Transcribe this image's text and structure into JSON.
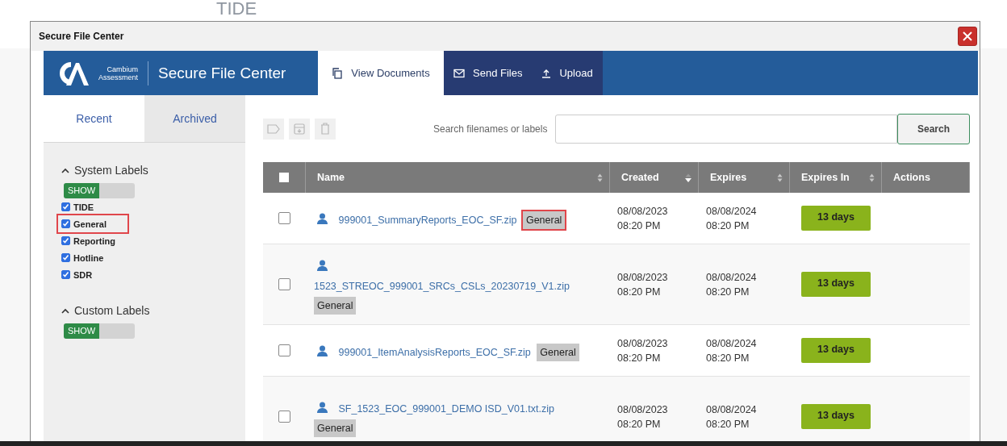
{
  "background": {
    "app_title": "TIDE"
  },
  "dialog": {
    "title": "Secure File Center"
  },
  "header": {
    "brand_line_1": "Cambium",
    "brand_line_2": "Assessment",
    "title": "Secure File Center",
    "nav": [
      {
        "label": "View Documents",
        "kind": "copy",
        "selected": true
      },
      {
        "label": "Send Files",
        "kind": "mail",
        "selected": false
      },
      {
        "label": "Upload",
        "kind": "upload",
        "selected": false
      }
    ]
  },
  "sidebar": {
    "tabs": [
      {
        "label": "Recent",
        "selected": true
      },
      {
        "label": "Archived",
        "selected": false
      }
    ],
    "sections": [
      {
        "title": "System Labels",
        "expanded": true,
        "toggle": {
          "label": "SHOW",
          "on": true
        },
        "labels": [
          {
            "name": "TIDE",
            "checked": true,
            "highlighted": false
          },
          {
            "name": "General",
            "checked": true,
            "highlighted": true
          },
          {
            "name": "Reporting",
            "checked": true,
            "highlighted": false
          },
          {
            "name": "Hotline",
            "checked": true,
            "highlighted": false
          },
          {
            "name": "SDR",
            "checked": true,
            "highlighted": false
          }
        ]
      },
      {
        "title": "Custom Labels",
        "expanded": true,
        "toggle": {
          "label": "SHOW",
          "on": true
        }
      }
    ]
  },
  "toolbar": {
    "actions": [
      {
        "kind": "tag",
        "disabled": true
      },
      {
        "kind": "archive",
        "disabled": true
      },
      {
        "kind": "trash",
        "disabled": true
      }
    ],
    "search_label": "Search filenames or labels",
    "search_button": "Search"
  },
  "table": {
    "select_all": {
      "checked": false
    },
    "columns": [
      {
        "label": "Name",
        "sortable": true,
        "sorted_descending": false
      },
      {
        "label": "Created",
        "sortable": true,
        "sorted_descending": true
      },
      {
        "label": "Expires",
        "sortable": true,
        "sorted_descending": false
      },
      {
        "label": "Expires In",
        "sortable": true,
        "sorted_descending": false
      },
      {
        "label": "Actions",
        "sortable": false,
        "sorted_descending": false
      }
    ],
    "rows": [
      {
        "checked": false,
        "name": "999001_SummaryReports_EOC_SF.zip",
        "tag": "General",
        "tag_highlighted": true,
        "created_date": "08/08/2023",
        "created_time": "08:20 PM",
        "expires_date": "08/08/2024",
        "expires_time": "08:20 PM",
        "expires_in": "13 days"
      },
      {
        "checked": false,
        "name": "1523_STREOC_999001_SRCs_CSLs_20230719_V1.zip",
        "tag": "General",
        "tag_highlighted": false,
        "created_date": "08/08/2023",
        "created_time": "08:20 PM",
        "expires_date": "08/08/2024",
        "expires_time": "08:20 PM",
        "expires_in": "13 days"
      },
      {
        "checked": false,
        "name": "999001_ItemAnalysisReports_EOC_SF.zip",
        "tag": "General",
        "tag_highlighted": false,
        "created_date": "08/08/2023",
        "created_time": "08:20 PM",
        "expires_date": "08/08/2024",
        "expires_time": "08:20 PM",
        "expires_in": "13 days"
      },
      {
        "checked": false,
        "name": "SF_1523_EOC_999001_DEMO ISD_V01.txt.zip",
        "tag": "General",
        "tag_highlighted": false,
        "created_date": "08/08/2023",
        "created_time": "08:20 PM",
        "expires_date": "08/08/2024",
        "expires_time": "08:20 PM",
        "expires_in": "13 days"
      }
    ]
  }
}
